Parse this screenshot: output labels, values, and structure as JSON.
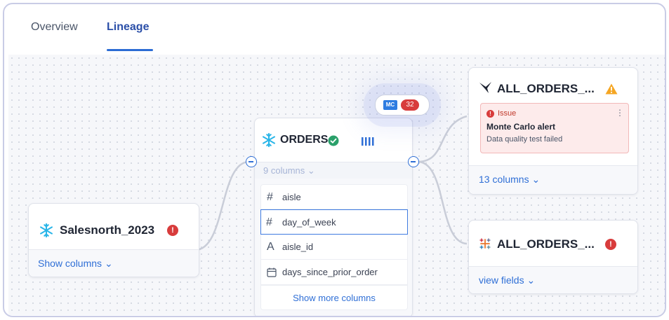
{
  "tabs": [
    {
      "label": "Overview",
      "active": false
    },
    {
      "label": "Lineage",
      "active": true
    }
  ],
  "nodes": {
    "source": {
      "title": "Salesnorth_2023",
      "icon": "snowflake-icon",
      "status": "error",
      "footer_link": "Show columns"
    },
    "orders": {
      "title": "ORDERS",
      "icon": "snowflake-icon",
      "verified": true,
      "columns_summary": "9 columns",
      "columns": [
        {
          "icon": "#",
          "name": "aisle",
          "selected": false
        },
        {
          "icon": "#",
          "name": "day_of_week",
          "selected": true
        },
        {
          "icon": "A",
          "name": "aisle_id",
          "selected": false
        },
        {
          "icon": "calendar-icon",
          "name": "days_since_prior_order",
          "selected": false
        }
      ],
      "show_more": "Show more columns",
      "badge": {
        "label": "MC",
        "count": "32"
      }
    },
    "target_top": {
      "title": "ALL_ORDERS_...",
      "icon": "bird-icon",
      "status": "warning",
      "alert": {
        "type": "Issue",
        "title": "Monte Carlo alert",
        "message": "Data quality test failed"
      },
      "footer_link": "13 columns"
    },
    "target_bottom": {
      "title": "ALL_ORDERS_...",
      "icon": "tableau-icon",
      "status": "error",
      "footer_link": "view fields"
    }
  },
  "colors": {
    "accent": "#2f6fd6",
    "error": "#d83c3c",
    "warning": "#f5a623",
    "snowflake": "#29b5e8",
    "verified": "#2aa06a"
  }
}
